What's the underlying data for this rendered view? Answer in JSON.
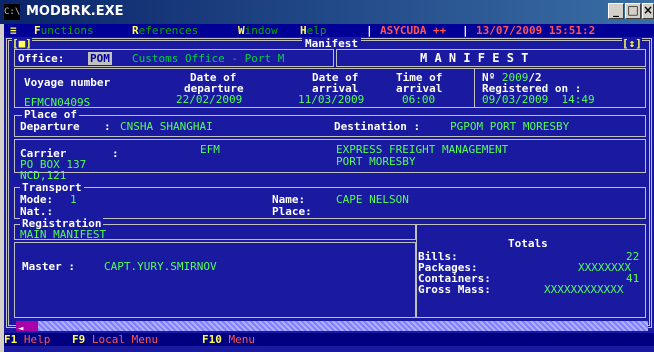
{
  "window": {
    "icon_text": "C:\\",
    "title": "MODBRK.EXE",
    "min_glyph": "_",
    "max_glyph": "□",
    "close_glyph": "×"
  },
  "menu": {
    "sys": "≡",
    "items": [
      {
        "hot": "F",
        "rest": "unctions"
      },
      {
        "hot": "R",
        "rest": "eferences"
      },
      {
        "hot": "W",
        "rest": "indow"
      },
      {
        "hot": "H",
        "rest": "elp"
      }
    ],
    "app": "ASYCUDA ++",
    "datetime": "13/07/2009 15:51:2"
  },
  "frame": {
    "left_marker": "[■]",
    "title": "Manifest",
    "right_marker": "[↕]"
  },
  "office": {
    "label": "Office:",
    "code": "POM",
    "name": "Customs Office - Port M"
  },
  "manifest_title": "M A N I F E S T",
  "voyage": {
    "label": "Voyage number",
    "value": "EFMCN0409S"
  },
  "date_departure": {
    "label1": "Date of",
    "label2": "departure",
    "value": "22/02/2009"
  },
  "date_arrival": {
    "label1": "Date of",
    "label2": "arrival",
    "value": "11/03/2009"
  },
  "time_arrival": {
    "label1": "Time of",
    "label2": "arrival",
    "value": "06:00"
  },
  "registration_no": {
    "label": "Nº",
    "year": "2009",
    "sep": "/",
    "seq": "2",
    "registered_label": "Registered on :",
    "date": "09/03/2009",
    "time": "14:49"
  },
  "place_of_departure": {
    "legend": "Place of",
    "label": "Departure",
    "colon": ":",
    "value": "CNSHA SHANGHAI"
  },
  "destination": {
    "label": "Destination :",
    "value": "PGPOM PORT MORESBY"
  },
  "carrier": {
    "label": "Carrier",
    "colon": ":",
    "code": "EFM",
    "name": "EXPRESS FREIGHT MANAGEMENT",
    "address1": "PO BOX 137",
    "address2": "NCD,121",
    "city": "PORT MORESBY"
  },
  "transport": {
    "legend": "Transport",
    "mode_label": "Mode:",
    "mode_value": "1",
    "nat_label": "Nat.:",
    "name_label": "Name:",
    "name_value": "CAPE NELSON",
    "place_label": "Place:"
  },
  "registration": {
    "legend": "Registration",
    "value": "MAIN MANIFEST"
  },
  "master": {
    "label": "Master :",
    "value": "CAPT.YURY.SMIRNOV"
  },
  "totals": {
    "title": "Totals",
    "bills_label": "Bills:",
    "bills_value": "22",
    "packages_label": "Packages:",
    "packages_value": "XXXXXXXX",
    "containers_label": "Containers:",
    "containers_value": "41",
    "gross_label": "Gross Mass:",
    "gross_value": "XXXXXXXXXXXX"
  },
  "scroll_arrow": "◄",
  "fkeys": [
    {
      "key": "F1",
      "label": "Help"
    },
    {
      "key": "F9",
      "label": "Local Menu"
    },
    {
      "key": "F10",
      "label": "Menu"
    }
  ]
}
